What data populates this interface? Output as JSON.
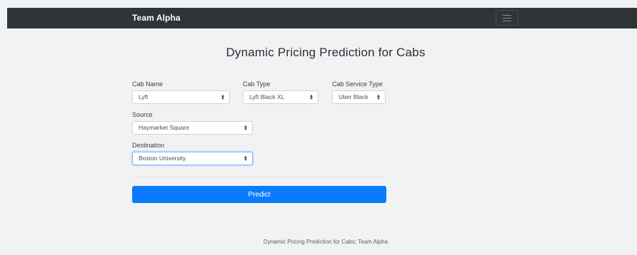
{
  "navbar": {
    "brand": "Team Alpha",
    "toggler_icon": "hamburger-icon"
  },
  "form": {
    "title": "Dynamic Pricing Prediction for Cabs",
    "cab_name": {
      "label": "Cab Name",
      "value": "Lyft"
    },
    "cab_type": {
      "label": "Cab Type",
      "value": "Lyft Black XL"
    },
    "cab_service_type": {
      "label": "Cab Service Type",
      "value": "Uber Black"
    },
    "source": {
      "label": "Source",
      "value": "Haymarket Square"
    },
    "destination": {
      "label": "Destination",
      "value": "Boston University"
    },
    "predict_label": "Predict"
  },
  "footer": {
    "text": "Dynamic Pricing Prediction for Cabs; Team Alpha"
  },
  "colors": {
    "navbar_bg": "#2f3438",
    "page_bg": "#f1f2f4",
    "primary": "#0a7bff"
  }
}
